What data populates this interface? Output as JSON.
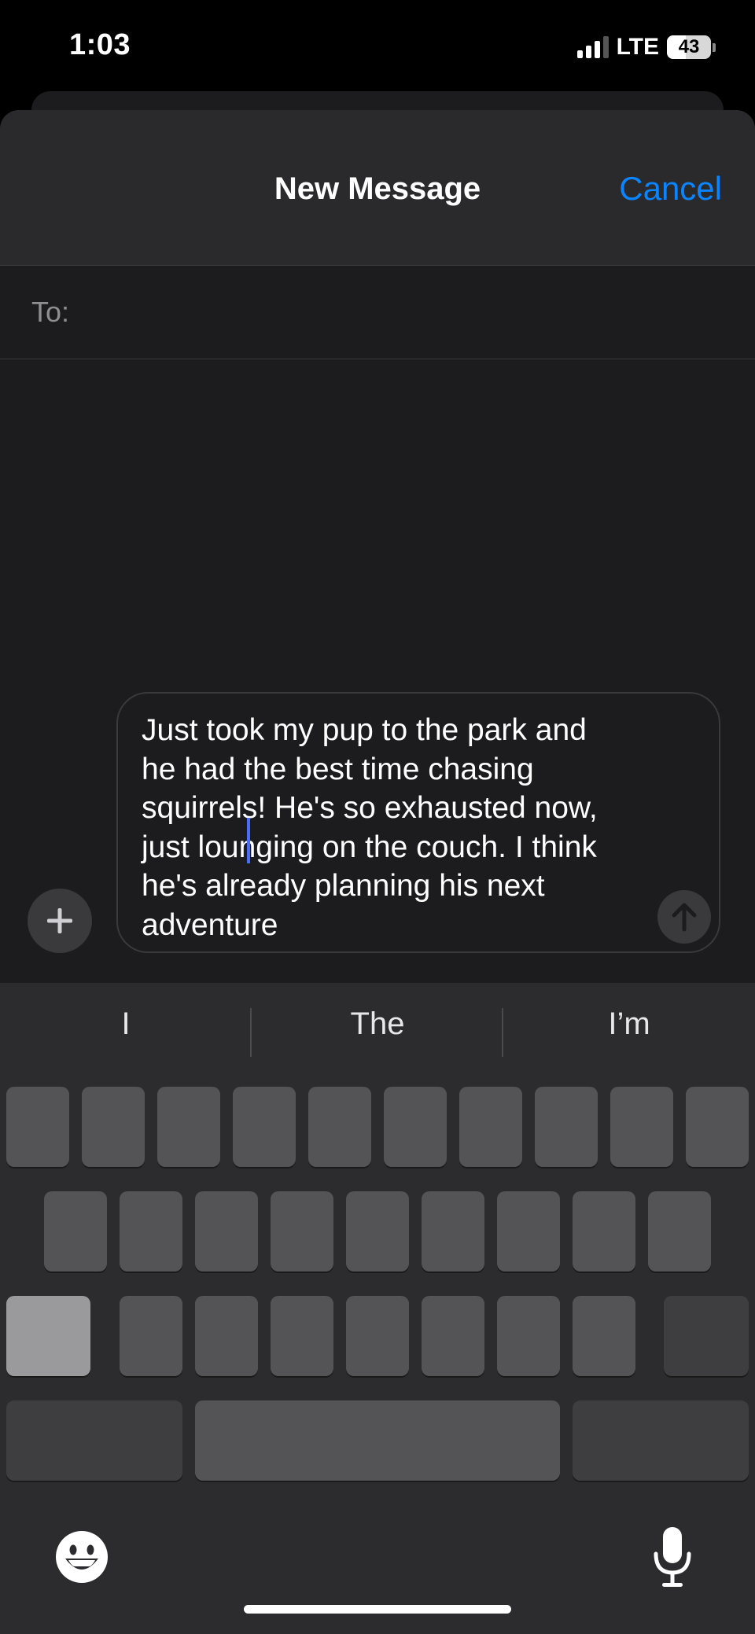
{
  "status_bar": {
    "time": "1:03",
    "network": "LTE",
    "battery": "43"
  },
  "sheet": {
    "title": "New Message",
    "cancel_label": "Cancel",
    "to_label": "To:"
  },
  "composer": {
    "message": "Just took my pup to the park and\nhe had the best time chasing\nsquirrels! He's so exhausted now,\njust lounging on the couch. I think\nhe's already planning his next\nadventure"
  },
  "keyboard": {
    "suggestions": [
      "I",
      "The",
      "I’m"
    ]
  },
  "colors": {
    "accent": "#0a84ff",
    "sheet_bg": "#1c1c1e",
    "key_bg": "#545456"
  }
}
